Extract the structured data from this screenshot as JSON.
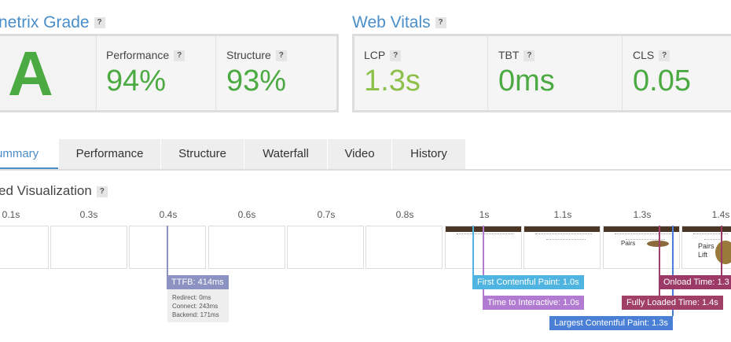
{
  "grade": {
    "title": "netrix Grade",
    "letter": "A",
    "performance_label": "Performance",
    "performance_value": "94%",
    "structure_label": "Structure",
    "structure_value": "93%"
  },
  "vitals": {
    "title": "Web Vitals",
    "lcp_label": "LCP",
    "lcp_value": "1.3s",
    "tbt_label": "TBT",
    "tbt_value": "0ms",
    "cls_label": "CLS",
    "cls_value": "0.05"
  },
  "help_glyph": "?",
  "tabs": [
    "ummary",
    "Performance",
    "Structure",
    "Waterfall",
    "Video",
    "History"
  ],
  "visualization": {
    "title": "ed Visualization",
    "ticks": [
      "0.1s",
      "0.3s",
      "0.4s",
      "0.6s",
      "0.7s",
      "0.8s",
      "1s",
      "1.1s",
      "1.3s",
      "1.4s"
    ],
    "thumb_text_1": "Pairs",
    "thumb_text_2": "Pairs",
    "thumb_text_3": "Lift",
    "markers": {
      "ttfb": "TTFB: 414ms",
      "fcp": "First Contentful Paint: 1.0s",
      "tti": "Time to Interactive: 1.0s",
      "lcp": "Largest Contentful Paint: 1.3s",
      "onload": "Onload Time: 1.3",
      "fully_loaded": "Fully Loaded Time: 1.4s"
    },
    "ttfb_details": {
      "redirect": "Redirect: 0ms",
      "connect": "Connect: 243ms",
      "backend": "Backend: 171ms"
    }
  },
  "colors": {
    "accent": "#4a8ec9",
    "green": "#4caa42",
    "lcp_green": "#8cc04a",
    "ttfb": "#8c92c2",
    "fcp": "#4fb4e0",
    "tti": "#b07bd1",
    "lcp": "#4a7fd6",
    "onload": "#9b3a66",
    "fully_loaded": "#a04069"
  }
}
